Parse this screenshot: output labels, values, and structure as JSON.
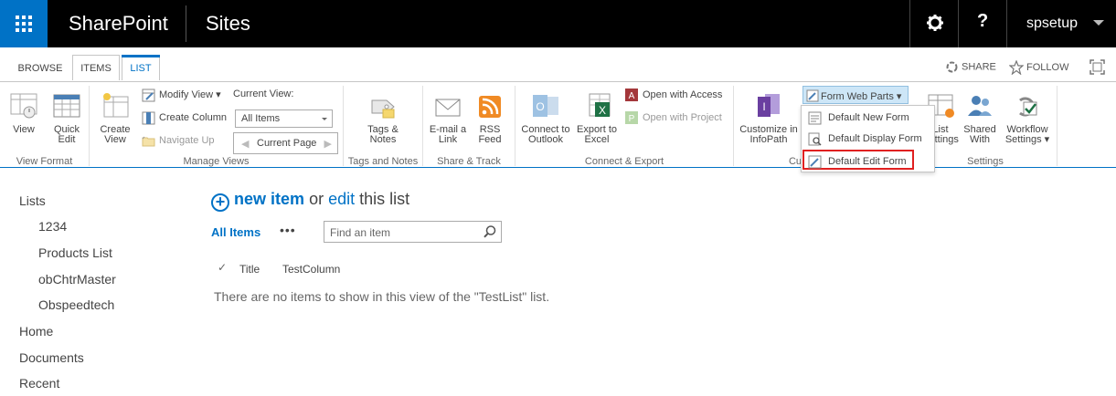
{
  "suite": {
    "brand": "SharePoint",
    "site_title": "Sites",
    "help_label": "?",
    "user_name": "spsetup"
  },
  "tabs": {
    "browse": "BROWSE",
    "items": "ITEMS",
    "list": "LIST"
  },
  "actions": {
    "share": "SHARE",
    "follow": "FOLLOW"
  },
  "ribbon": {
    "view_format": {
      "label": "View Format",
      "view": "View",
      "quick_edit_1": "Quick",
      "quick_edit_2": "Edit"
    },
    "manage_views": {
      "label": "Manage Views",
      "create_view_1": "Create",
      "create_view_2": "View",
      "modify_view": "Modify View",
      "create_column": "Create Column",
      "navigate_up": "Navigate Up",
      "current_view_label": "Current View:",
      "current_view_value": "All Items",
      "current_page": "Current Page"
    },
    "tags_notes": {
      "label": "Tags and Notes",
      "tags_1": "Tags &",
      "tags_2": "Notes"
    },
    "share_track": {
      "label": "Share & Track",
      "email_1": "E-mail a",
      "email_2": "Link",
      "rss_1": "RSS",
      "rss_2": "Feed"
    },
    "connect_export": {
      "label": "Connect & Export",
      "outlook_1": "Connect to",
      "outlook_2": "Outlook",
      "excel_1": "Export to",
      "excel_2": "Excel",
      "open_access": "Open with Access",
      "open_project": "Open with Project"
    },
    "customize": {
      "label_partial": "Cu",
      "infopath_1": "Customize in",
      "infopath_2": "InfoPath",
      "form_web_parts": "Form Web Parts"
    },
    "settings": {
      "label": "Settings",
      "list_settings_1": "List",
      "list_settings_2": "Settings",
      "shared_with_1": "Shared",
      "shared_with_2": "With",
      "workflow_1": "Workflow",
      "workflow_2": "Settings"
    }
  },
  "menu": {
    "items": [
      "Default New Form",
      "Default Display Form",
      "Default Edit Form"
    ]
  },
  "leftnav": {
    "items": [
      "Lists",
      "1234",
      "Products List",
      "obChtrMaster",
      "Obspeedtech",
      "Home",
      "Documents",
      "Recent"
    ]
  },
  "main": {
    "new_item": "new item",
    "or": "or",
    "edit": "edit",
    "this_list": "this list",
    "view_all_items": "All Items",
    "more": "•••",
    "search_placeholder": "Find an item",
    "columns": [
      "Title",
      "TestColumn"
    ],
    "empty_message": "There are no items to show in this view of the \"TestList\" list."
  },
  "colors": {
    "accent": "#0072c6",
    "suite_bar": "#000000",
    "highlight_box": "#e02020"
  }
}
